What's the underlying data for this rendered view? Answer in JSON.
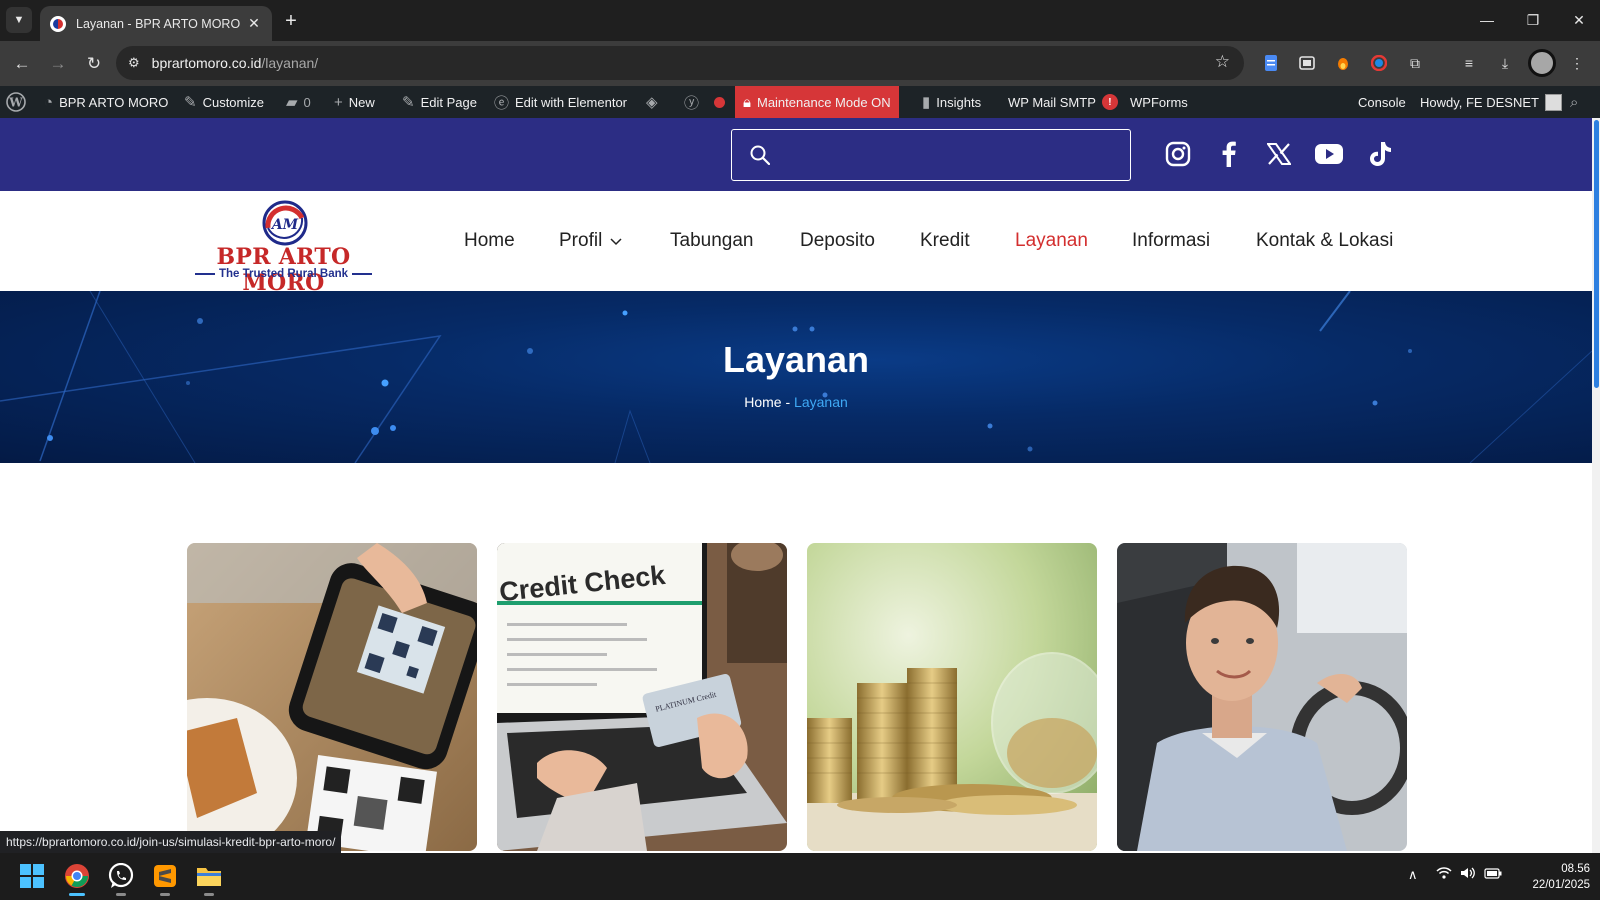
{
  "browser": {
    "tab_title": "Layanan - BPR ARTO MORO",
    "url_host": "bprartomoro.co.id",
    "url_path": "/layanan/",
    "status_url": "https://bprartomoro.co.id/join-us/simulasi-kredit-bpr-arto-moro/"
  },
  "wp_admin_bar": {
    "site_name": "BPR ARTO MORO",
    "customize": "Customize",
    "comments_count": "0",
    "new": "New",
    "edit_page": "Edit Page",
    "edit_elementor": "Edit with Elementor",
    "maintenance": "Maintenance Mode ON",
    "insights": "Insights",
    "wp_mail_smtp": "WP Mail SMTP",
    "smtp_badge": "!",
    "wpforms": "WPForms",
    "console": "Console",
    "howdy": "Howdy, FE DESNET"
  },
  "site": {
    "logo_title": "BPR ARTO MORO",
    "logo_tagline": "The Trusted Rural Bank",
    "logo_mark": "AM",
    "search_placeholder": "",
    "social": [
      "instagram-icon",
      "facebook-icon",
      "x-icon",
      "youtube-icon",
      "tiktok-icon"
    ],
    "nav": [
      "Home",
      "Profil",
      "Tabungan",
      "Deposito",
      "Kredit",
      "Layanan",
      "Informasi",
      "Kontak & Lokasi"
    ],
    "nav_active": "Layanan",
    "colors": {
      "topbar": "#2c2d84",
      "brand_red": "#c62828",
      "brand_blue": "#22308e",
      "active_nav": "#d32f2f",
      "breadcrumb_current": "#3fa9f5"
    }
  },
  "hero": {
    "title": "Layanan",
    "breadcrumb_home": "Home",
    "breadcrumb_sep": "-",
    "breadcrumb_current": "Layanan"
  },
  "cards": {
    "card2_text": "Credit Check",
    "card2_card_text": "PLATINUM Credit"
  },
  "taskbar": {
    "time": "08.56",
    "date": "22/01/2025"
  }
}
